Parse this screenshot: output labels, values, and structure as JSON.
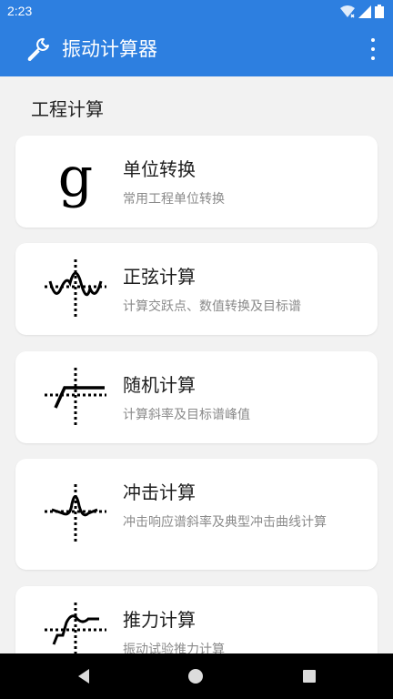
{
  "status_bar": {
    "time": "2:23"
  },
  "app_bar": {
    "title": "振动计算器"
  },
  "section": {
    "title": "工程计算"
  },
  "cards": [
    {
      "icon": "letter-g-icon",
      "title": "单位转换",
      "subtitle": "常用工程单位转换",
      "icon_glyph": "g"
    },
    {
      "icon": "sine-wave-icon",
      "title": "正弦计算",
      "subtitle": "计算交跃点、数值转换及目标谱"
    },
    {
      "icon": "random-profile-icon",
      "title": "随机计算",
      "subtitle": "计算斜率及目标谱峰值"
    },
    {
      "icon": "shock-pulse-icon",
      "title": "冲击计算",
      "subtitle": "冲击响应谱斜率及典型冲击曲线计算"
    },
    {
      "icon": "thrust-curve-icon",
      "title": "推力计算",
      "subtitle": "振动试验推力计算"
    }
  ],
  "colors": {
    "primary": "#2d7fe0",
    "background": "#f2f2f2",
    "card": "#ffffff"
  }
}
